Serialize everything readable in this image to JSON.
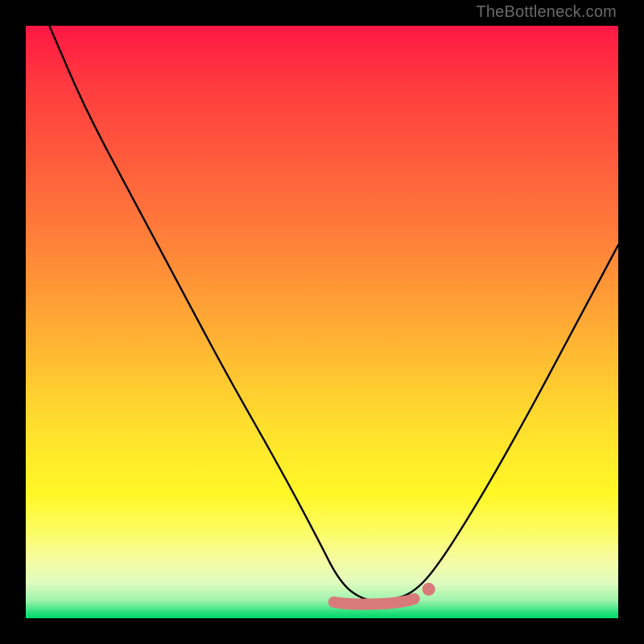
{
  "watermark": "TheBottleneck.com",
  "chart_data": {
    "type": "line",
    "title": "",
    "xlabel": "",
    "ylabel": "",
    "xlim": [
      0,
      100
    ],
    "ylim": [
      0,
      100
    ],
    "series": [
      {
        "name": "bottleneck-curve",
        "x": [
          4,
          10,
          18,
          26,
          34,
          42,
          49,
          53,
          57,
          61,
          65,
          69,
          76,
          84,
          92,
          100
        ],
        "values": [
          100,
          86,
          71,
          56,
          41,
          27,
          14,
          6,
          3,
          3,
          4,
          8,
          19,
          33,
          48,
          63
        ]
      }
    ],
    "floor_band": {
      "x_start": 52,
      "x_end": 68,
      "y": 3
    },
    "colors": {
      "curve": "#000000",
      "floor_band": "#d97a7a"
    }
  }
}
